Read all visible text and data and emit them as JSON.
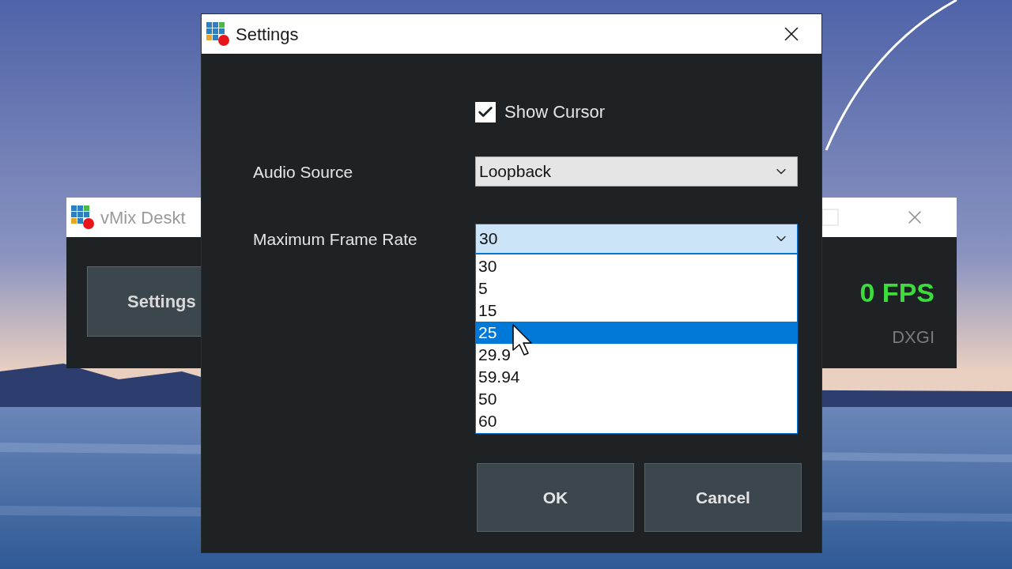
{
  "background_window": {
    "title": "vMix Deskt",
    "button": "Settings",
    "fps": "0 FPS",
    "capture_mode": "DXGI"
  },
  "dialog": {
    "title": "Settings",
    "show_cursor": {
      "label": "Show Cursor",
      "checked": true
    },
    "fields": [
      {
        "label": "Audio Source",
        "value": "Loopback",
        "open": false
      },
      {
        "label": "Maximum Frame Rate",
        "value": "30",
        "open": true
      }
    ],
    "options": [
      {
        "label": "30",
        "selected": false
      },
      {
        "label": "5",
        "selected": false
      },
      {
        "label": "15",
        "selected": false
      },
      {
        "label": "25",
        "selected": true
      },
      {
        "label": "29.9",
        "selected": false
      },
      {
        "label": "59.94",
        "selected": false
      },
      {
        "label": "50",
        "selected": false
      },
      {
        "label": "60",
        "selected": false
      }
    ],
    "buttons": [
      "OK",
      "Cancel"
    ]
  }
}
